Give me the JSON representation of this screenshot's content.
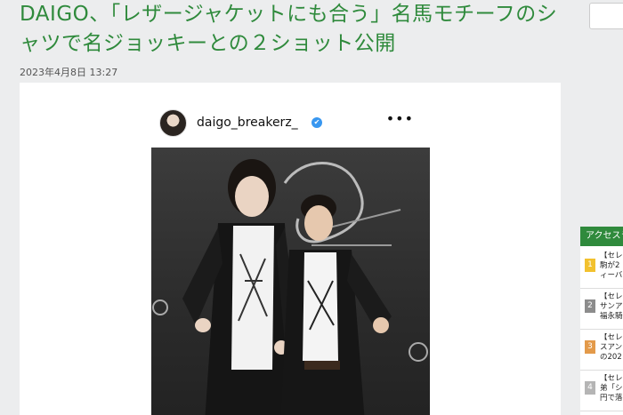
{
  "article": {
    "headline": "DAIGO、「レザージャケットにも合う」名馬モチーフのシャツで名ジョッキーとの２ショット公開",
    "date": "2023年4月8日 13:27"
  },
  "instagram": {
    "username": "daigo_breakerz_",
    "verified_icon": "✔",
    "more_icon": "•••"
  },
  "ranking": {
    "tab_label": "アクセスラ",
    "items": [
      {
        "num": "1",
        "text": "【セレ\n駒が2\nィーバ",
        "color": "#f2c12e"
      },
      {
        "num": "2",
        "text": "【セレ\nサンア\n福永騎",
        "color": "#8c8c8c"
      },
      {
        "num": "3",
        "text": "【セレ\nスアン\nの202",
        "color": "#e39a4a"
      },
      {
        "num": "4",
        "text": "【セレ\n弟「シ\n円で落",
        "color": "#b5b5b5"
      }
    ]
  }
}
